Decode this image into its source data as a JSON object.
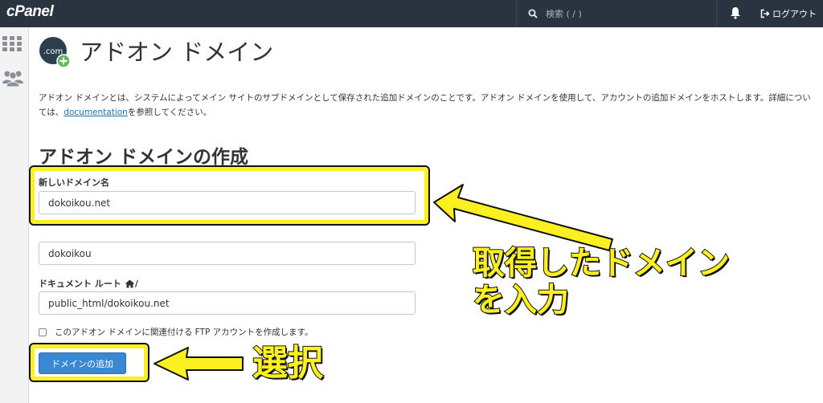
{
  "app": {
    "logo": "cPanel",
    "search_placeholder": "検索 ( / )",
    "logout_label": "ログアウト"
  },
  "page": {
    "title": "アドオン ドメイン",
    "icon_text": ".com",
    "description_before_link": "アドオン ドメインとは、システムによってメイン サイトのサブドメインとして保存された追加ドメインのことです。アドオン ドメインを使用して、アカウントの追加ドメインをホストします。詳細については、",
    "description_link": "documentation",
    "description_after_link": "を参照してください。"
  },
  "form": {
    "section_title": "アドオン ドメインの作成",
    "new_domain_label": "新しいドメイン名",
    "new_domain_value": "dokoikou.net",
    "subdomain_value": "dokoikou",
    "docroot_label": "ドキュメント ルート",
    "docroot_suffix": "/",
    "docroot_value": "public_html/dokoikou.net",
    "ftp_checkbox_label": "このアドオン ドメインに関連付ける FTP アカウントを作成します。",
    "ftp_checked": false,
    "submit_label": "ドメインの追加"
  },
  "annotations": {
    "input_note_line1": "取得したドメイン",
    "input_note_line2": "を入力",
    "select_note": "選択"
  },
  "colors": {
    "topbar": "#2a3440",
    "accent": "#3a87d4",
    "annotation": "#fcf020"
  }
}
